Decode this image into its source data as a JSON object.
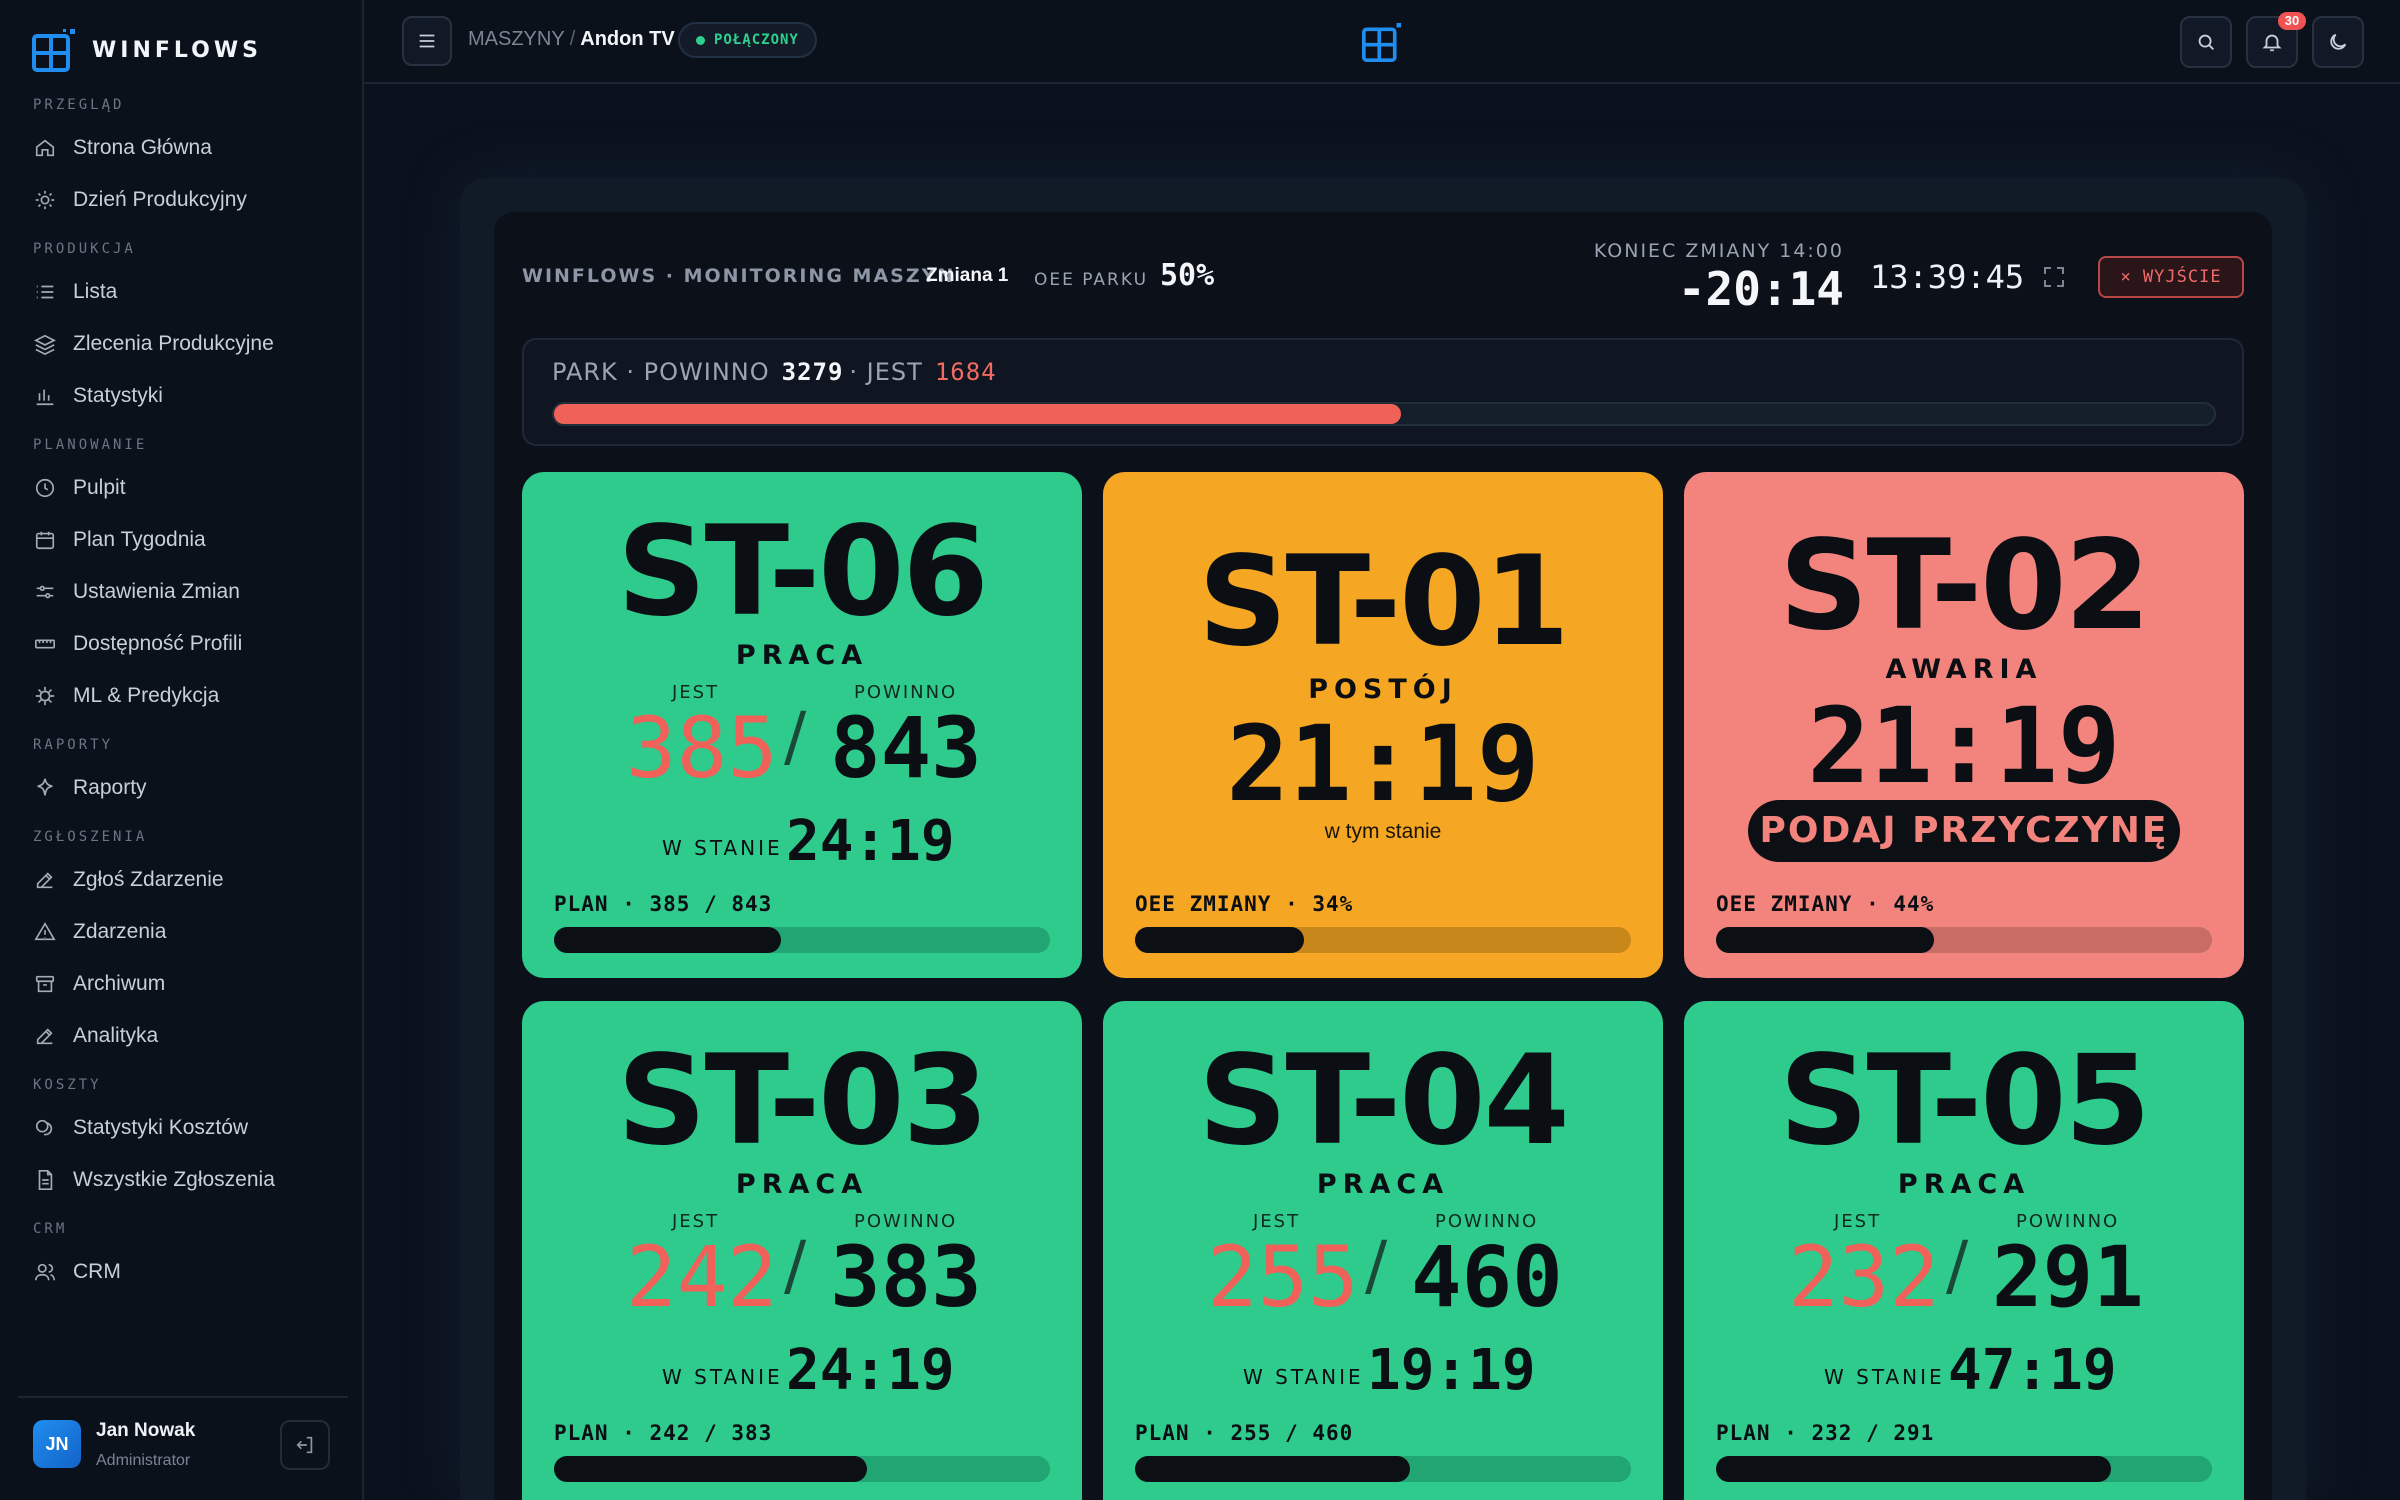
{
  "app": {
    "brand": "WINFLOWS",
    "colors": {
      "accent": "#1f8ef0",
      "green": "#2ecb8d",
      "amber": "#f5a623",
      "red": "#f3847d",
      "bad": "#f0615a"
    }
  },
  "sidebar": {
    "sections": [
      {
        "label": "PRZEGLĄD",
        "items": [
          {
            "label": "Strona Główna",
            "icon": "home-icon"
          },
          {
            "label": "Dzień Produkcyjny",
            "icon": "sun-icon"
          }
        ]
      },
      {
        "label": "PRODUKCJA",
        "items": [
          {
            "label": "Lista",
            "icon": "list-icon"
          },
          {
            "label": "Zlecenia Produkcyjne",
            "icon": "layers-icon"
          },
          {
            "label": "Statystyki",
            "icon": "bar-chart-icon"
          }
        ]
      },
      {
        "label": "PLANOWANIE",
        "items": [
          {
            "label": "Pulpit",
            "icon": "clock-icon"
          },
          {
            "label": "Plan Tygodnia",
            "icon": "calendar-icon"
          },
          {
            "label": "Ustawienia Zmian",
            "icon": "sliders-icon"
          },
          {
            "label": "Dostępność Profili",
            "icon": "ruler-icon"
          },
          {
            "label": "ML & Predykcja",
            "icon": "chip-icon"
          }
        ]
      },
      {
        "label": "RAPORTY",
        "items": [
          {
            "label": "Raporty",
            "icon": "sparkle-icon"
          }
        ]
      },
      {
        "label": "ZGŁOSZENIA",
        "items": [
          {
            "label": "Zgłoś Zdarzenie",
            "icon": "pencil-icon"
          },
          {
            "label": "Zdarzenia",
            "icon": "warning-icon"
          },
          {
            "label": "Archiwum",
            "icon": "archive-icon"
          },
          {
            "label": "Analityka",
            "icon": "pencil-icon"
          }
        ]
      },
      {
        "label": "KOSZTY",
        "items": [
          {
            "label": "Statystyki Kosztów",
            "icon": "coins-icon"
          },
          {
            "label": "Wszystkie Zgłoszenia",
            "icon": "document-icon"
          }
        ]
      },
      {
        "label": "CRM",
        "items": [
          {
            "label": "CRM",
            "icon": "users-icon"
          }
        ]
      }
    ],
    "user": {
      "initials": "JN",
      "name": "Jan Nowak",
      "role": "Administrator"
    }
  },
  "topbar": {
    "breadcrumb": {
      "parent": "MASZYNY",
      "separator": "/",
      "current": "Andon TV"
    },
    "connection": "POŁĄCZONY",
    "notifications_count": "30"
  },
  "board": {
    "title": "WINFLOWS · MONITORING MASZYN",
    "shift": "Zmiana 1",
    "oee_label": "OEE PARKU",
    "oee_value": "50%",
    "end_label": "KONIEC ZMIANY 14:00",
    "countdown": "-20:14",
    "clock": "13:39:45",
    "exit_label": "× WYJŚCIE",
    "park": {
      "label": "PARK · POWINNO",
      "should": "3279",
      "mid": "· JEST",
      "actual": "1684",
      "progress": 0.51
    }
  },
  "labels": {
    "jest": "JEST",
    "powinno": "POWINNO",
    "w_stanie": "W STANIE",
    "w_tym_stanie": "w tym stanie",
    "reason": "PODAJ PRZYCZYNĘ"
  },
  "machines": [
    {
      "name": "ST-06",
      "status": "PRACA",
      "jest": "385",
      "powinno": "843",
      "w_stanie": "24:19",
      "plan": "PLAN · 385 / 843",
      "progress": 0.457
    },
    {
      "name": "ST-01",
      "status": "POSTÓJ",
      "time": "21:19",
      "oee": "OEE ZMIANY · 34%",
      "progress": 0.34
    },
    {
      "name": "ST-02",
      "status": "AWARIA",
      "time": "21:19",
      "oee": "OEE ZMIANY · 44%",
      "progress": 0.44
    },
    {
      "name": "ST-03",
      "status": "PRACA",
      "jest": "242",
      "powinno": "383",
      "w_stanie": "24:19",
      "plan": "PLAN · 242 / 383",
      "progress": 0.632
    },
    {
      "name": "ST-04",
      "status": "PRACA",
      "jest": "255",
      "powinno": "460",
      "w_stanie": "19:19",
      "plan": "PLAN · 255 / 460",
      "progress": 0.554
    },
    {
      "name": "ST-05",
      "status": "PRACA",
      "jest": "232",
      "powinno": "291",
      "w_stanie": "47:19",
      "plan": "PLAN · 232 / 291",
      "progress": 0.797
    }
  ]
}
